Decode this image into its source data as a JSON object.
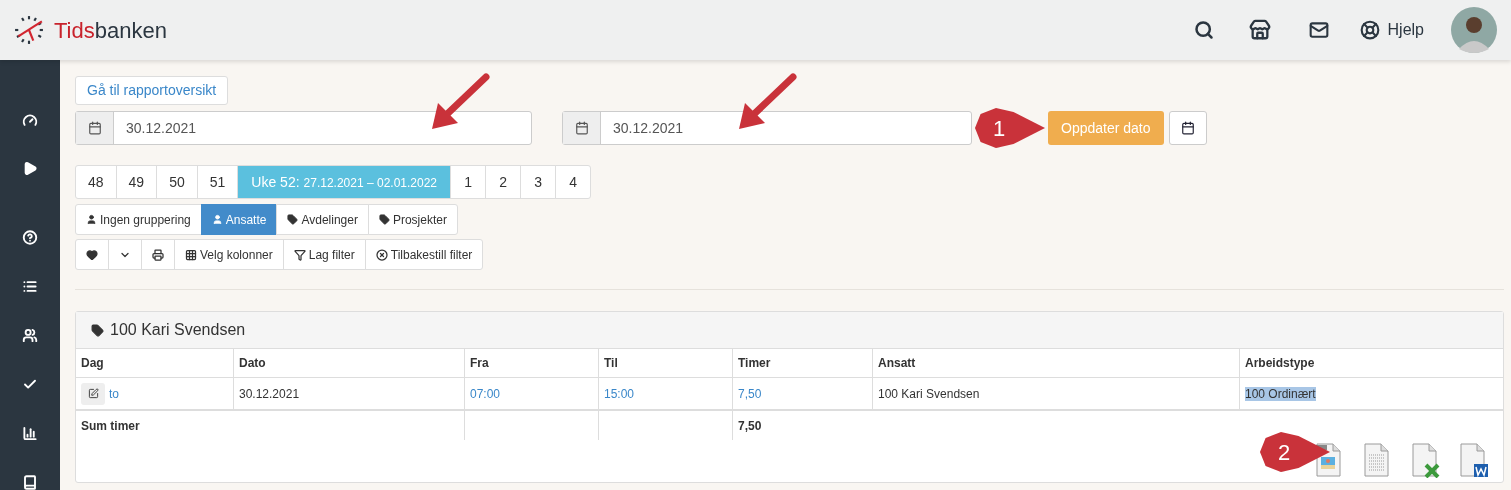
{
  "header": {
    "logo": {
      "first": "Tids",
      "second": "banken"
    },
    "help_label": "Hjelp"
  },
  "sidebar": {
    "items": [
      {
        "kind": "gauge"
      },
      {
        "kind": "play"
      },
      {
        "kind": "help"
      },
      {
        "kind": "list"
      },
      {
        "kind": "users"
      },
      {
        "kind": "check"
      },
      {
        "kind": "chart"
      },
      {
        "kind": "book"
      }
    ]
  },
  "overview_link": "Gå til rapportoversikt",
  "date_from": {
    "value": "30.12.2021"
  },
  "date_to": {
    "value": "30.12.2021"
  },
  "update_button": "Oppdater dato",
  "weeks": [
    {
      "label": "48",
      "selected": false
    },
    {
      "label": "49",
      "selected": false
    },
    {
      "label": "50",
      "selected": false
    },
    {
      "label": "51",
      "selected": false
    },
    {
      "label": "Uke 52:",
      "range": "27.12.2021 – 02.01.2022",
      "selected": true
    },
    {
      "label": "1",
      "selected": false
    },
    {
      "label": "2",
      "selected": false
    },
    {
      "label": "3",
      "selected": false
    },
    {
      "label": "4",
      "selected": false
    }
  ],
  "grouping": [
    {
      "label": "Ingen gruppering",
      "kind": "user",
      "selected": false
    },
    {
      "label": "Ansatte",
      "kind": "user",
      "selected": true
    },
    {
      "label": "Avdelinger",
      "kind": "tag",
      "selected": false
    },
    {
      "label": "Prosjekter",
      "kind": "tag",
      "selected": false
    }
  ],
  "toolbar": [
    {
      "kind": "heart"
    },
    {
      "kind": "caret"
    },
    {
      "kind": "print"
    },
    {
      "kind": "columns",
      "label": "Velg kolonner"
    },
    {
      "kind": "filter",
      "label": "Lag filter"
    },
    {
      "kind": "reset",
      "label": "Tilbakestill filter"
    }
  ],
  "panel": {
    "title": "100 Kari Svendsen",
    "table": {
      "columns": [
        "Dag",
        "Dato",
        "Fra",
        "Til",
        "Timer",
        "Ansatt",
        "Arbeidstype"
      ],
      "rows": [
        {
          "dag": "to",
          "dato": "30.12.2021",
          "fra": "07:00",
          "til": "15:00",
          "timer": "7,50",
          "ansatt": "100 Kari Svendsen",
          "arbeidstype": "100 Ordinært",
          "arbeidstype_highlighted": true
        }
      ],
      "sum_label": "Sum timer",
      "sum_value": "7,50"
    },
    "exports": [
      {
        "kind": "png"
      },
      {
        "kind": "text"
      },
      {
        "kind": "excel"
      },
      {
        "kind": "word"
      }
    ]
  },
  "callouts": [
    "1",
    "2"
  ]
}
